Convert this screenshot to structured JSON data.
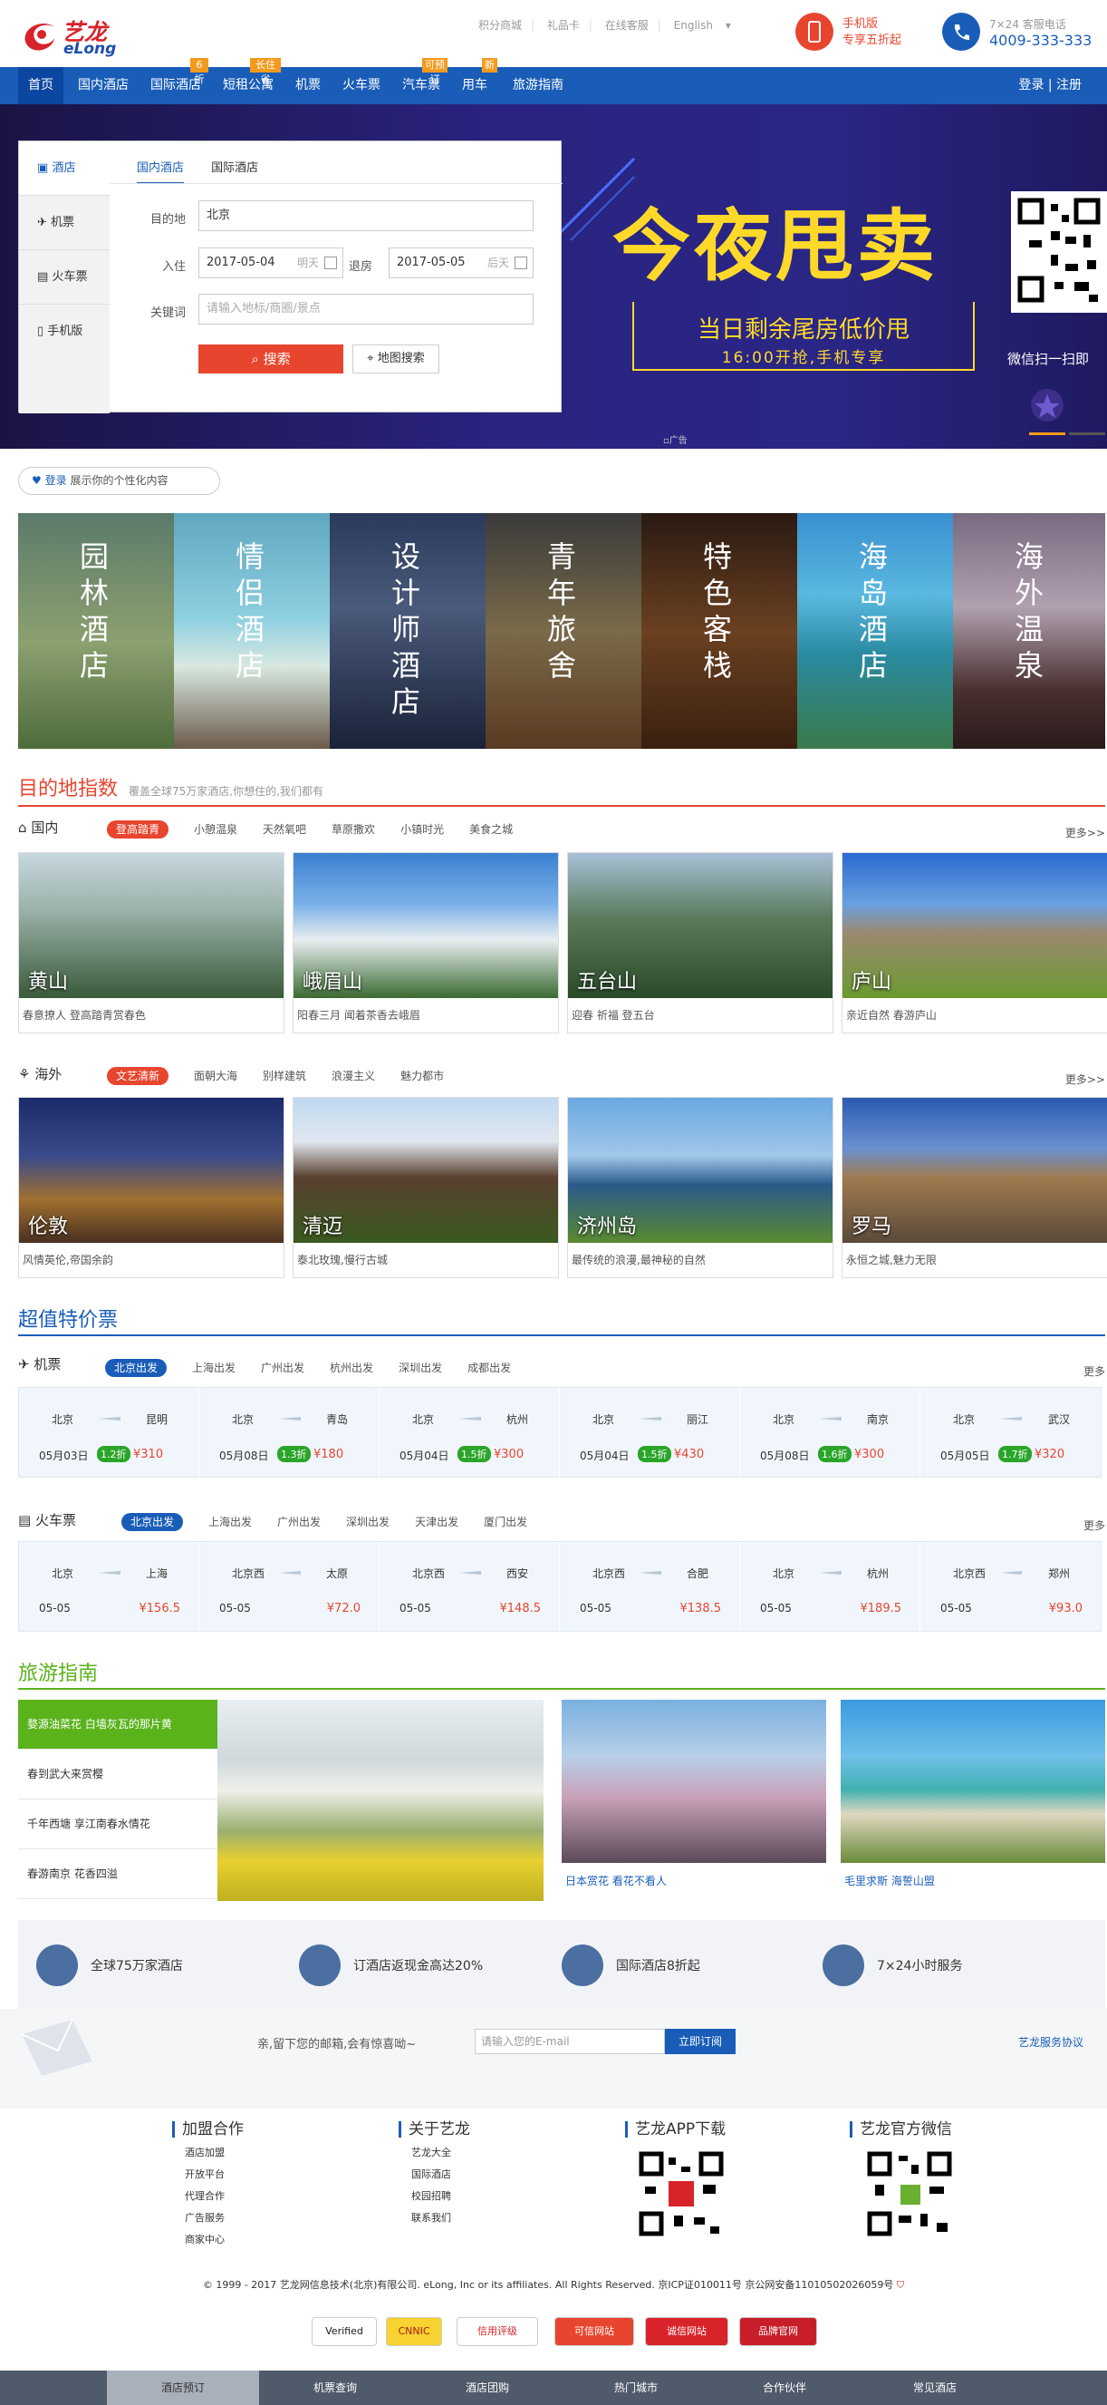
{
  "header": {
    "logo_cn": "艺龙",
    "logo_en": "eLong",
    "links": [
      "积分商城",
      "礼品卡",
      "在线客服",
      "English"
    ],
    "mobile": {
      "line1": "手机版",
      "line2": "专享五折起"
    },
    "service": {
      "line1": "7×24 客服电话",
      "phone": "4009-333-333"
    }
  },
  "nav": {
    "items": [
      "首页",
      "国内酒店",
      "国际酒店",
      "短租公寓",
      "机票",
      "火车票",
      "汽车票",
      "用车",
      "旅游指南"
    ],
    "tags": [
      {
        "text": "6折",
        "item": 2
      },
      {
        "text": "长住省",
        "item": 3
      },
      {
        "text": "可预订",
        "item": 6
      },
      {
        "text": "新",
        "item": 7
      }
    ],
    "login": "登录 | 注册"
  },
  "search": {
    "side": [
      "酒店",
      "机票",
      "火车票",
      "手机版"
    ],
    "tabs": [
      "国内酒店",
      "国际酒店"
    ],
    "dest_label": "目的地",
    "dest_value": "北京",
    "checkin_label": "入住",
    "checkin_value": "2017-05-04",
    "checkin_hint": "明天",
    "checkout_label": "退房",
    "checkout_value": "2017-05-05",
    "checkout_hint": "后天",
    "kw_label": "关键词",
    "kw_placeholder": "请输入地标/商圈/景点",
    "search_btn": "搜索",
    "map_btn": "地图搜索"
  },
  "banner": {
    "title": "今夜甩卖",
    "sub1": "当日剩余尾房低价甩",
    "sub2": "16:00开抢,手机专享",
    "qr_label": "微信扫一扫即",
    "ad": "广告"
  },
  "login_pill": {
    "link": "登录",
    "text": "展示你的个性化内容"
  },
  "themes": [
    "园林酒店",
    "情侣酒店",
    "设计师酒店",
    "青年旅舍",
    "特色客栈",
    "海岛酒店",
    "海外温泉"
  ],
  "dest": {
    "title": "目的地指数",
    "subtitle": "覆盖全球75万家酒店,你想住的,我们都有",
    "domestic": {
      "label": "国内",
      "tabs": [
        "登高踏青",
        "小憩温泉",
        "天然氧吧",
        "草原撒欢",
        "小镇时光",
        "美食之城"
      ],
      "more": "更多>>",
      "cards": [
        {
          "name": "黄山",
          "desc": "春意撩人 登高踏青赏春色"
        },
        {
          "name": "峨眉山",
          "desc": "阳春三月 闻着茶香去峨眉"
        },
        {
          "name": "五台山",
          "desc": "迎春 祈福 登五台"
        },
        {
          "name": "庐山",
          "desc": "亲近自然 春游庐山"
        }
      ]
    },
    "abroad": {
      "label": "海外",
      "tabs": [
        "文艺清新",
        "面朝大海",
        "别样建筑",
        "浪漫主义",
        "魅力都市"
      ],
      "more": "更多>>",
      "cards": [
        {
          "name": "伦敦",
          "desc": "风情英伦,帝国余韵"
        },
        {
          "name": "清迈",
          "desc": "泰北玫瑰,慢行古城"
        },
        {
          "name": "济州岛",
          "desc": "最传统的浪漫,最神秘的自然"
        },
        {
          "name": "罗马",
          "desc": "永恒之城,魅力无限"
        }
      ]
    }
  },
  "deals": {
    "title": "超值特价票",
    "flight": {
      "label": "机票",
      "tabs": [
        "北京出发",
        "上海出发",
        "广州出发",
        "杭州出发",
        "深圳出发",
        "成都出发"
      ],
      "more": "更多",
      "items": [
        {
          "from": "北京",
          "to": "昆明",
          "date": "05月03日",
          "disc": "1.2折",
          "price": "¥310"
        },
        {
          "from": "北京",
          "to": "青岛",
          "date": "05月08日",
          "disc": "1.3折",
          "price": "¥180"
        },
        {
          "from": "北京",
          "to": "杭州",
          "date": "05月04日",
          "disc": "1.5折",
          "price": "¥300"
        },
        {
          "from": "北京",
          "to": "丽江",
          "date": "05月04日",
          "disc": "1.5折",
          "price": "¥430"
        },
        {
          "from": "北京",
          "to": "南京",
          "date": "05月08日",
          "disc": "1.6折",
          "price": "¥300"
        },
        {
          "from": "北京",
          "to": "武汉",
          "date": "05月05日",
          "disc": "1.7折",
          "price": "¥320"
        }
      ]
    },
    "train": {
      "label": "火车票",
      "tabs": [
        "北京出发",
        "上海出发",
        "广州出发",
        "深圳出发",
        "天津出发",
        "厦门出发"
      ],
      "more": "更多",
      "items": [
        {
          "from": "北京",
          "to": "上海",
          "date": "05-05",
          "price": "¥156.5"
        },
        {
          "from": "北京西",
          "to": "太原",
          "date": "05-05",
          "price": "¥72.0"
        },
        {
          "from": "北京西",
          "to": "西安",
          "date": "05-05",
          "price": "¥148.5"
        },
        {
          "from": "北京西",
          "to": "合肥",
          "date": "05-05",
          "price": "¥138.5"
        },
        {
          "from": "北京",
          "to": "杭州",
          "date": "05-05",
          "price": "¥189.5"
        },
        {
          "from": "北京西",
          "to": "郑州",
          "date": "05-05",
          "price": "¥93.0"
        }
      ]
    }
  },
  "guide": {
    "title": "旅游指南",
    "list": [
      "婺源油菜花 白墙灰瓦的那片黄",
      "春到武大来赏樱",
      "千年西塘 享江南春水情花",
      "春游南京 花香四溢"
    ],
    "cards": [
      "日本赏花 看花不看人",
      "毛里求斯 海誓山盟"
    ]
  },
  "features": [
    "全球75万家酒店",
    "订酒店返现金高达20%",
    "国际酒店8折起",
    "7×24小时服务"
  ],
  "subscribe": {
    "text": "亲,留下您的邮箱,会有惊喜呦~",
    "placeholder": "请输入您的E-mail",
    "btn": "立即订阅",
    "agreement": "艺龙服务协议"
  },
  "footer": {
    "cols": [
      {
        "title": "加盟合作",
        "links": [
          "酒店加盟",
          "开放平台",
          "代理合作",
          "广告服务",
          "商家中心"
        ]
      },
      {
        "title": "关于艺龙",
        "links": [
          "艺龙大全",
          "国际酒店",
          "校园招聘",
          "联系我们"
        ]
      },
      {
        "title": "艺龙APP下载",
        "links": []
      },
      {
        "title": "艺龙官方微信",
        "links": []
      }
    ],
    "copyright": "© 1999 - 2017 艺龙网信息技术(北京)有限公司. eLong, Inc or its affiliates. All Rights Reserved. 京ICP证010011号 京公网安备11010502026059号",
    "badges": [
      "Verified",
      "CNNIC",
      "信用评级",
      "可信网站",
      "诚信网站",
      "品牌官网"
    ],
    "bottom_nav": [
      "酒店预订",
      "机票查询",
      "酒店团购",
      "热门城市",
      "合作伙伴",
      "常见酒店"
    ]
  },
  "colors": {
    "brand_blue": "#1a5db8",
    "accent_red": "#e8452e",
    "guide_green": "#5ab31b",
    "discount_green": "#2aa52a"
  }
}
